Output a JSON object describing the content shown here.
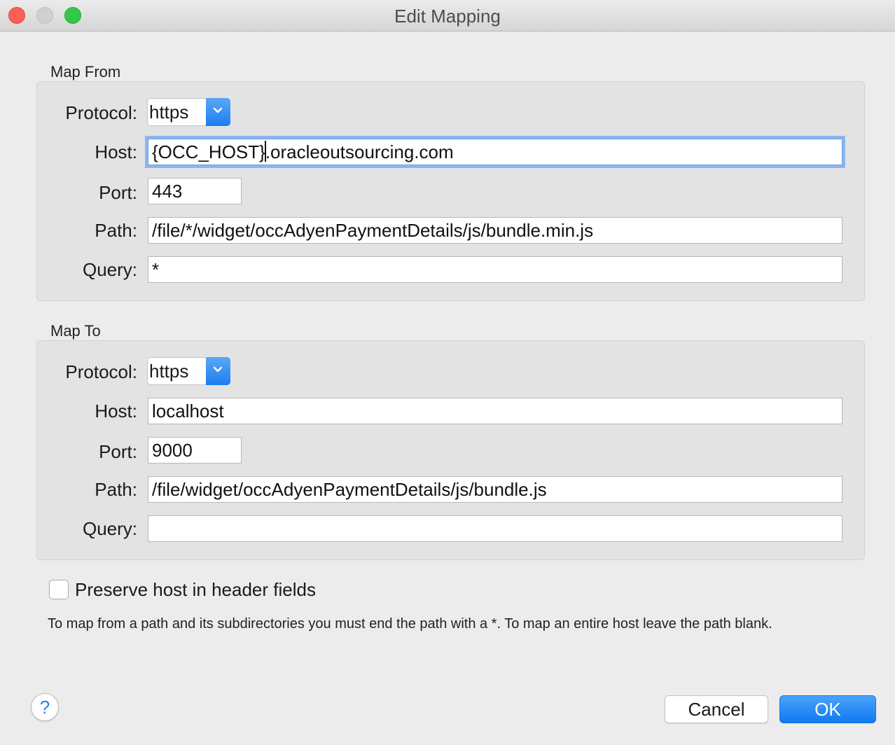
{
  "window": {
    "title": "Edit Mapping"
  },
  "map_from": {
    "section_label": "Map From",
    "protocol_label": "Protocol:",
    "protocol_value": "https",
    "host_label": "Host:",
    "host_value_before_caret": "{OCC_HOST}",
    "host_value_after_caret": ".oracleoutsourcing.com",
    "port_label": "Port:",
    "port_value": "443",
    "path_label": "Path:",
    "path_value": "/file/*/widget/occAdyenPaymentDetails/js/bundle.min.js",
    "query_label": "Query:",
    "query_value": "*"
  },
  "map_to": {
    "section_label": "Map To",
    "protocol_label": "Protocol:",
    "protocol_value": "https",
    "host_label": "Host:",
    "host_value": "localhost",
    "port_label": "Port:",
    "port_value": "9000",
    "path_label": "Path:",
    "path_value": "/file/widget/occAdyenPaymentDetails/js/bundle.js",
    "query_label": "Query:",
    "query_value": ""
  },
  "options": {
    "preserve_host_label": "Preserve host in header fields",
    "preserve_host_checked": false
  },
  "hint_text": "To map from a path and its subdirectories you must end the path with a *. To map an entire host leave the path blank.",
  "buttons": {
    "help": "?",
    "cancel": "Cancel",
    "ok": "OK"
  },
  "colors": {
    "accent": "#1c7ef0",
    "close": "#fc5f57",
    "maximize": "#34c748"
  }
}
